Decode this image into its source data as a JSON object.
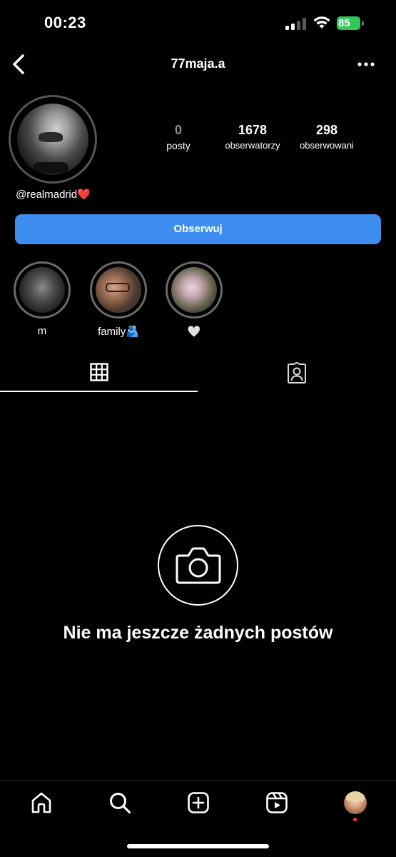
{
  "status_bar": {
    "time": "00:23",
    "battery": "85"
  },
  "header": {
    "username": "77maja.a"
  },
  "profile": {
    "stats": {
      "posts": {
        "value": "0",
        "label": "posty"
      },
      "followers": {
        "value": "1678",
        "label": "obserwatorzy"
      },
      "following": {
        "value": "298",
        "label": "obserwowani"
      }
    },
    "bio": "@realmadrid❤️",
    "follow_button": "Obserwuj"
  },
  "highlights": [
    {
      "name": "m"
    },
    {
      "name": "family🫂"
    },
    {
      "name": "🤍"
    }
  ],
  "empty_state": {
    "text": "Nie ma jeszcze żadnych postów"
  },
  "colors": {
    "accent": "#3d8ef0",
    "battery": "#34c759",
    "background": "#000000",
    "notification_dot": "#ff3040"
  },
  "icons": [
    "back-arrow-icon",
    "more-options-icon",
    "grid-icon",
    "tagged-icon",
    "camera-icon",
    "home-icon",
    "search-icon",
    "create-icon",
    "reels-icon"
  ]
}
